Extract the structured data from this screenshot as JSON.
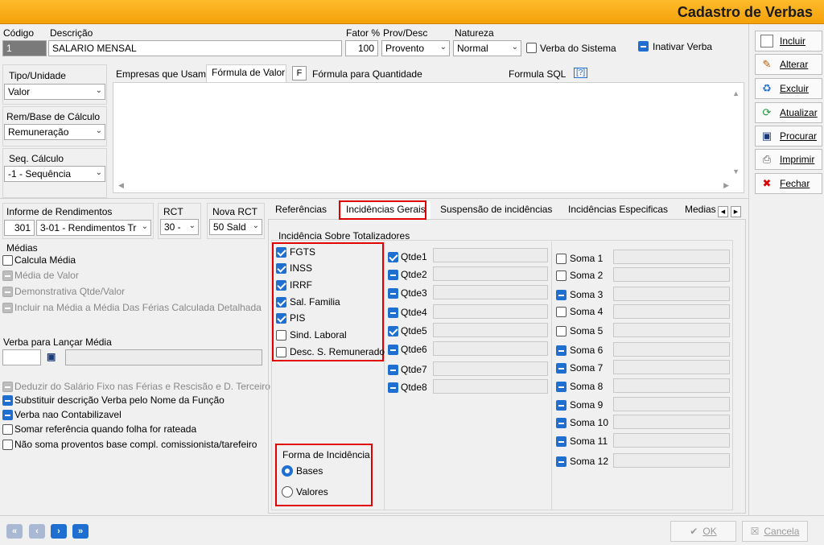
{
  "window": {
    "title": "Cadastro de Verbas"
  },
  "header": {
    "codigo_label": "Código",
    "codigo_value": "1",
    "descricao_label": "Descrição",
    "descricao_value": "SALARIO MENSAL",
    "fator_label": "Fator %",
    "fator_value": "100",
    "prov_label": "Prov/Desc",
    "prov_value": "Provento",
    "natureza_label": "Natureza",
    "natureza_value": "Normal",
    "verba_sistema_label": "Verba do Sistema",
    "inativar_label": "Inativar Verba"
  },
  "left": {
    "tipo_label": "Tipo/Unidade",
    "tipo_value": "Valor",
    "rem_label": "Rem/Base de Cálculo",
    "rem_value": "Remuneração",
    "seq_label": "Seq. Cálculo",
    "seq_value": "-1 - Sequência"
  },
  "formula_tabs": {
    "empresas": "Empresas que Usam",
    "valor": "Fórmula de Valor",
    "f": "F",
    "quantidade": "Fórmula para Quantidade",
    "sql": "Formula SQL",
    "sql_icon": "[?]"
  },
  "sidebar": {
    "incluir": "Incluir",
    "alterar": "Alterar",
    "excluir": "Excluir",
    "atualizar": "Atualizar",
    "procurar": "Procurar",
    "imprimir": "Imprimir",
    "fechar": "Fechar"
  },
  "informe": {
    "label": "Informe de Rendimentos",
    "code": "301",
    "value": "3-01 - Rendimentos Tr",
    "rct_label": "RCT",
    "rct_value": "30 -",
    "nova_rct_label": "Nova RCT",
    "nova_rct_value": "50 Sald"
  },
  "medias": {
    "title": "Médias",
    "calcula": "Calcula Média",
    "media_valor": "Média de Valor",
    "demonstrativa": "Demonstrativa Qtde/Valor",
    "incluir_ferias": "Incluir na Média a Média Das Férias Calculada Detalhada",
    "verba_lancar": "Verba para Lançar Média"
  },
  "options": {
    "deduzir": "Deduzir do Salário Fixo nas  Férias e Rescisão e D. Terceiro",
    "substituir": "Substituir descrição Verba pelo Nome da Função",
    "nao_contab": "Verba nao Contabilizavel",
    "somar_ref": "Somar referência quando folha for rateada",
    "nao_soma": "Não soma proventos base compl. comissionista/tarefeiro"
  },
  "tabs": {
    "referencias": "Referências",
    "incidencias_gerais": "Incidências Gerais",
    "suspensao": "Suspensão de incidências",
    "especificas": "Incidências Especificas",
    "medias": "Medias"
  },
  "incidencia": {
    "group_label": "Incidência Sobre Totalizadores",
    "fgts": "FGTS",
    "inss": "INSS",
    "irrf": "IRRF",
    "sal_familia": "Sal. Familia",
    "pis": "PIS",
    "sind": "Sind. Laboral",
    "desc": "Desc. S. Remunerado"
  },
  "qtde": [
    "Qtde1",
    "Qtde2",
    "Qtde3",
    "Qtde4",
    "Qtde5",
    "Qtde6",
    "Qtde7",
    "Qtde8"
  ],
  "soma": [
    "Soma 1",
    "Soma 2",
    "Soma 3",
    "Soma 4",
    "Soma 5",
    "Soma 6",
    "Soma 7",
    "Soma 8",
    "Soma 9",
    "Soma 10",
    "Soma 11",
    "Soma 12"
  ],
  "forma": {
    "label": "Forma de Incidência",
    "bases": "Bases",
    "valores": "Valores"
  },
  "footer": {
    "ok": "OK",
    "cancela": "Cancela"
  },
  "colors": {
    "accent": "#1f6fd1",
    "title_bar": "#f5a10a",
    "highlight": "#e00000"
  }
}
